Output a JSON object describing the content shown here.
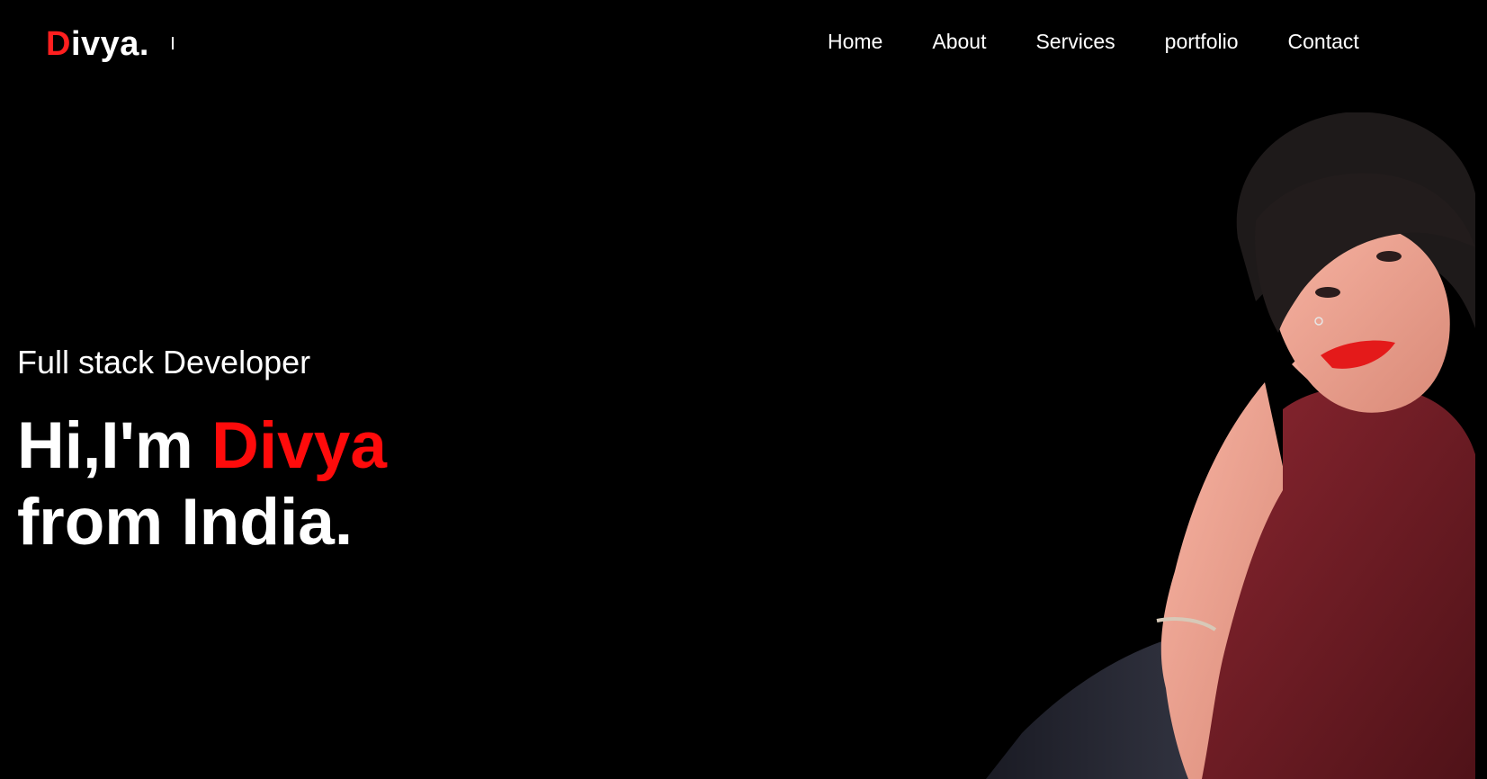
{
  "brand": {
    "logo_initial": "D",
    "logo_rest": "ivya."
  },
  "nav": {
    "items": [
      {
        "label": "Home"
      },
      {
        "label": "About"
      },
      {
        "label": "Services"
      },
      {
        "label": "portfolio"
      },
      {
        "label": "Contact"
      }
    ]
  },
  "hero": {
    "role": "Full stack Developer",
    "greeting_prefix": "Hi,I'm ",
    "greeting_name": "Divya",
    "greeting_line2": "from India."
  },
  "colors": {
    "background": "#000000",
    "text": "#ffffff",
    "accent": "#ff1f1f",
    "dress": "#6f1c22"
  },
  "icons": {
    "logo_cursor": "text-caret-icon"
  }
}
